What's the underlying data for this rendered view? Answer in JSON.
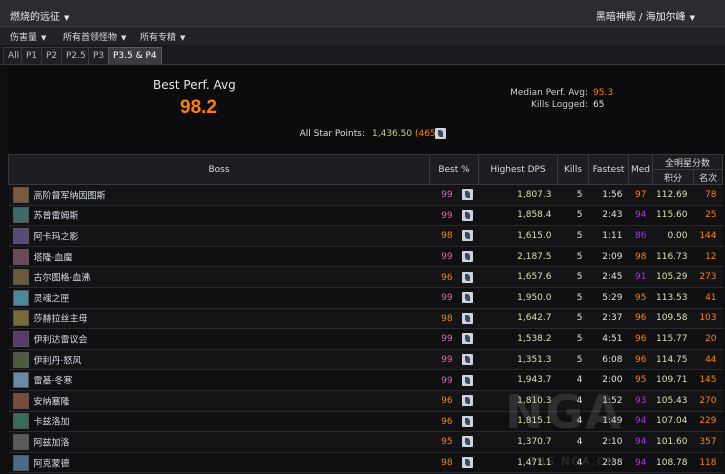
{
  "topbar": {
    "left_title": "燃烧的远征",
    "right_title": "黑暗神殿 / 海加尔峰"
  },
  "filters": [
    {
      "label": "伤害量"
    },
    {
      "label": "所有首领怪物"
    },
    {
      "label": "所有专精"
    }
  ],
  "phases": [
    "All",
    "P1",
    "P2",
    "P2.5",
    "P3",
    "P3.5 & P4"
  ],
  "active_phase": "P3.5 & P4",
  "summary": {
    "best_perf_label": "Best Perf. Avg",
    "best_perf_value": "98.2",
    "median_label": "Median Perf. Avg:",
    "median_value": "95.3",
    "kills_label": "Kills Logged:",
    "kills_value": "65",
    "allstar_label": "All Star Points:",
    "allstar_points": "1,436.50",
    "allstar_rank": "(465)"
  },
  "table": {
    "headers": {
      "boss": "Boss",
      "best": "Best %",
      "dps": "Highest DPS",
      "kills": "Kills",
      "fastest": "Fastest",
      "med": "Med",
      "allstar": "全明星分数",
      "points": "积分",
      "rank": "名次"
    },
    "rows": [
      {
        "boss": "高阶督军纳因图斯",
        "best": "99",
        "dps": "1,807.3",
        "kills": "5",
        "fastest": "1:56",
        "med": "97",
        "points": "112.69",
        "rank": "78",
        "icon_color": "#7a5a3a"
      },
      {
        "boss": "苏普雷姆斯",
        "best": "99",
        "dps": "1,858.4",
        "kills": "5",
        "fastest": "2:43",
        "med": "94",
        "points": "115.60",
        "rank": "25",
        "icon_color": "#3d6a6a"
      },
      {
        "boss": "阿卡玛之影",
        "best": "98",
        "dps": "1,615.0",
        "kills": "5",
        "fastest": "1:11",
        "med": "86",
        "points": "0.00",
        "rank": "144",
        "icon_color": "#5a4a7a"
      },
      {
        "boss": "塔隆·血魔",
        "best": "99",
        "dps": "2,187.5",
        "kills": "5",
        "fastest": "2:09",
        "med": "98",
        "points": "116.73",
        "rank": "12",
        "icon_color": "#6a4a5a"
      },
      {
        "boss": "古尔图格·血沸",
        "best": "96",
        "dps": "1,657.6",
        "kills": "5",
        "fastest": "2:45",
        "med": "91",
        "points": "105.29",
        "rank": "273",
        "icon_color": "#6a5a3a"
      },
      {
        "boss": "灵魂之匣",
        "best": "99",
        "dps": "1,950.0",
        "kills": "5",
        "fastest": "5:29",
        "med": "95",
        "points": "113.53",
        "rank": "41",
        "icon_color": "#4a8a9a"
      },
      {
        "boss": "莎赫拉丝主母",
        "best": "98",
        "dps": "1,642.7",
        "kills": "5",
        "fastest": "2:37",
        "med": "96",
        "points": "109.58",
        "rank": "103",
        "icon_color": "#7a6a3a"
      },
      {
        "boss": "伊利达雷议会",
        "best": "99",
        "dps": "1,538.2",
        "kills": "5",
        "fastest": "4:51",
        "med": "96",
        "points": "115.77",
        "rank": "20",
        "icon_color": "#5a3a6a"
      },
      {
        "boss": "伊利丹·怒风",
        "best": "99",
        "dps": "1,351.3",
        "kills": "5",
        "fastest": "6:08",
        "med": "96",
        "points": "114.75",
        "rank": "44",
        "icon_color": "#4a5a3a"
      },
      {
        "boss": "雷基·冬寒",
        "best": "99",
        "dps": "1,943.7",
        "kills": "4",
        "fastest": "2:00",
        "med": "95",
        "points": "109.71",
        "rank": "145",
        "icon_color": "#6a8aaa"
      },
      {
        "boss": "安纳塞隆",
        "best": "96",
        "dps": "1,810.3",
        "kills": "4",
        "fastest": "1:52",
        "med": "93",
        "points": "105.43",
        "rank": "270",
        "icon_color": "#7a4a3a"
      },
      {
        "boss": "卡兹洛加",
        "best": "96",
        "dps": "1,815.1",
        "kills": "4",
        "fastest": "1:49",
        "med": "94",
        "points": "107.04",
        "rank": "229",
        "icon_color": "#3a6a5a"
      },
      {
        "boss": "阿兹加洛",
        "best": "95",
        "dps": "1,370.7",
        "kills": "4",
        "fastest": "2:10",
        "med": "94",
        "points": "101.60",
        "rank": "357",
        "icon_color": "#5a5a5a"
      },
      {
        "boss": "阿克蒙德",
        "best": "98",
        "dps": "1,471.1",
        "kills": "4",
        "fastest": "2:38",
        "med": "94",
        "points": "108.78",
        "rank": "118",
        "icon_color": "#4a6a8a"
      }
    ]
  },
  "colors": {
    "accent": "#ff8000",
    "pink": "#e268a8",
    "purple": "#a335ee",
    "blue": "#0070dd"
  },
  "watermark": {
    "main": "NGA",
    "sub": "BBS.NGA.CN"
  }
}
